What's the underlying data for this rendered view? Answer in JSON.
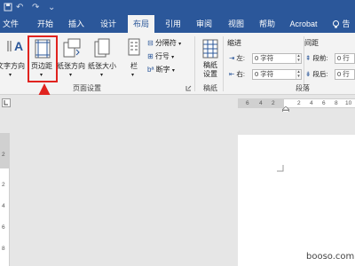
{
  "quick_access": {
    "undo": "↶",
    "redo": "↷",
    "customize": "⌄"
  },
  "tabs": [
    {
      "label": "文件"
    },
    {
      "label": "开始"
    },
    {
      "label": "插入"
    },
    {
      "label": "设计"
    },
    {
      "label": "布局",
      "active": true
    },
    {
      "label": "引用"
    },
    {
      "label": "审阅"
    },
    {
      "label": "视图"
    },
    {
      "label": "帮助"
    },
    {
      "label": "Acrobat"
    },
    {
      "label": "告"
    }
  ],
  "ribbon": {
    "page_setup": {
      "text_direction": "文字方向",
      "margins": "页边距",
      "orientation": "纸张方向",
      "size": "纸张大小",
      "columns": "栏",
      "breaks": "分隔符",
      "line_numbers": "行号",
      "hyphenation": "断字",
      "group_label": "页面设置"
    },
    "draft": {
      "button_line1": "稿纸",
      "button_line2": "设置",
      "group_label": "稿纸"
    },
    "indent": {
      "header": "缩进",
      "left_label": "左:",
      "left_value": "0 字符",
      "right_label": "右:",
      "right_value": "0 字符"
    },
    "spacing": {
      "header": "间距",
      "before_label": "段前:",
      "before_value": "0 行",
      "after_label": "段后:",
      "after_value": "0 行"
    },
    "paragraph_group_label": "段落"
  },
  "ruler": {
    "numbers": [
      "6",
      "4",
      "2",
      "2",
      "4",
      "6",
      "8",
      "10"
    ]
  },
  "vertical_ruler": {
    "numbers": [
      "2",
      "2",
      "4",
      "6",
      "8"
    ]
  },
  "watermark": "booso.com",
  "colors": {
    "brand": "#2b579a",
    "highlight": "#e0231f"
  }
}
